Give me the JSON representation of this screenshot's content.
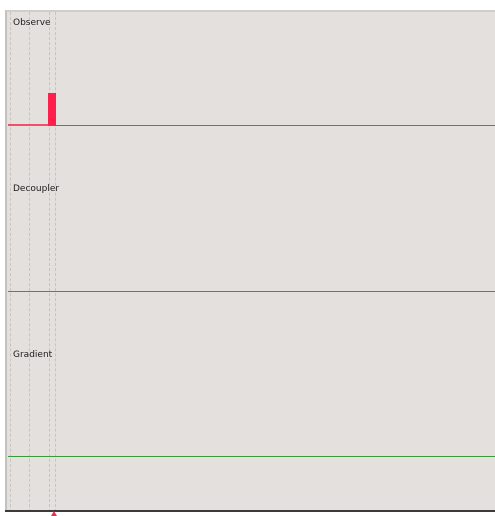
{
  "tracks": [
    {
      "label": "Observe"
    },
    {
      "label": "Decoupler"
    },
    {
      "label": "Gradient"
    }
  ],
  "colors": {
    "background": "#e3e0de",
    "baseline": "#3a9a3a",
    "pulse": "#ff1f4b",
    "axis": "#3b3b3b"
  }
}
